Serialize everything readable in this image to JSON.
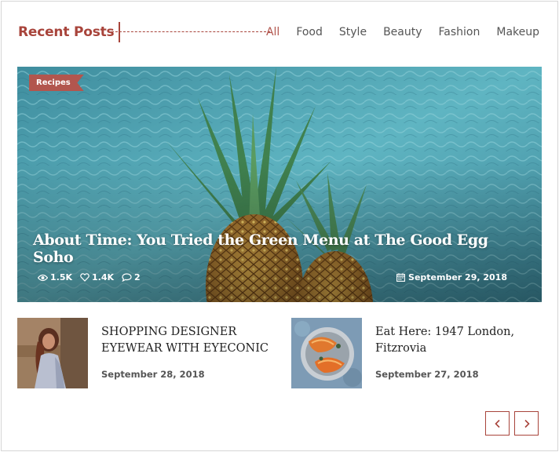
{
  "widget": {
    "title": "Recent Posts",
    "tabs": [
      {
        "label": "All",
        "active": true
      },
      {
        "label": "Food"
      },
      {
        "label": "Style"
      },
      {
        "label": "Beauty"
      },
      {
        "label": "Fashion"
      },
      {
        "label": "Makeup"
      }
    ]
  },
  "featured": {
    "category": "Recipes",
    "title": "About Time: You Tried the Green Menu at The Good Egg Soho",
    "views": "1.5K",
    "likes": "1.4K",
    "comments": "2",
    "date": "September 29, 2018",
    "icons": [
      "eye-icon",
      "heart-icon",
      "comment-icon",
      "calendar-icon"
    ]
  },
  "posts": [
    {
      "title": "SHOPPING DESIGNER EYEWEAR WITH EYECONIC",
      "date": "September 28, 2018"
    },
    {
      "title": "Eat Here: 1947 London, Fitzrovia",
      "date": "September 27, 2018"
    }
  ],
  "pager": {
    "prev_icon": "chevron-left-icon",
    "next_icon": "chevron-right-icon"
  },
  "colors": {
    "accent": "#a8443b",
    "badge": "#b2564e",
    "pool": "#4ea6b4"
  }
}
